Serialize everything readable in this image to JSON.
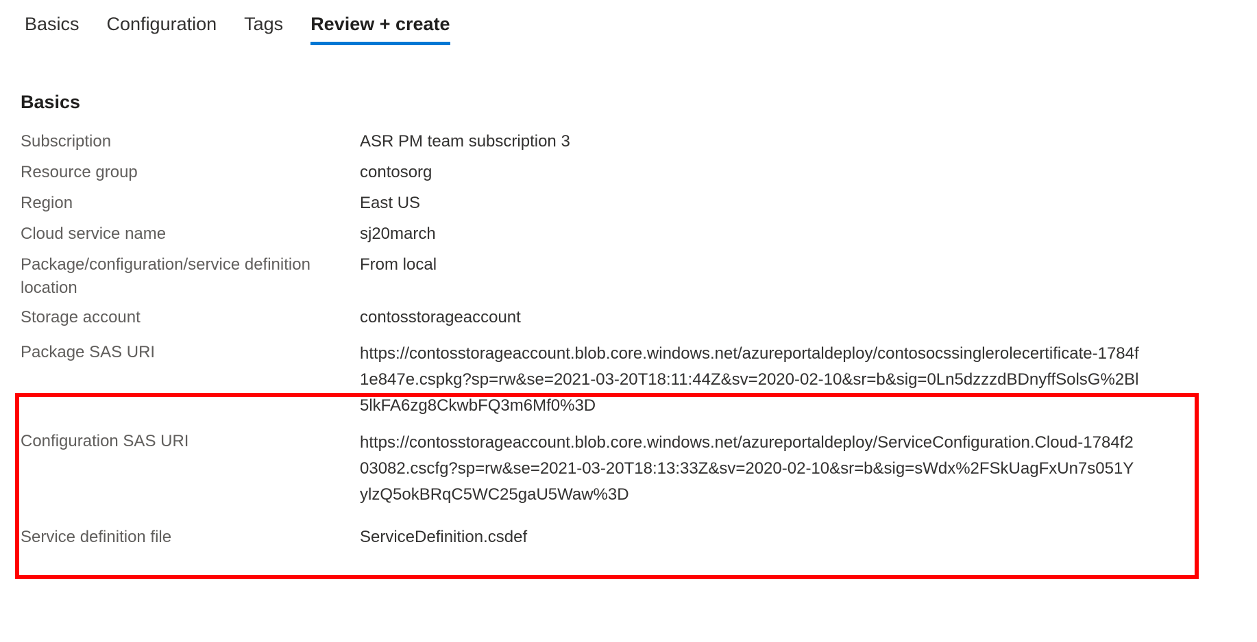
{
  "tabs": [
    {
      "label": "Basics",
      "active": false
    },
    {
      "label": "Configuration",
      "active": false
    },
    {
      "label": "Tags",
      "active": false
    },
    {
      "label": "Review + create",
      "active": true
    }
  ],
  "section": {
    "title": "Basics"
  },
  "fields": [
    {
      "label": "Subscription",
      "value": "ASR PM team subscription 3"
    },
    {
      "label": "Resource group",
      "value": "contosorg"
    },
    {
      "label": "Region",
      "value": "East US"
    },
    {
      "label": "Cloud service name",
      "value": "sj20march"
    },
    {
      "label": "Package/configuration/service definition location",
      "value": "From local"
    },
    {
      "label": "Storage account",
      "value": "contosstorageaccount"
    },
    {
      "label": "Package SAS URI",
      "value": "https://contosstorageaccount.blob.core.windows.net/azureportaldeploy/contosocssinglerolecertificate-1784f1e847e.cspkg?sp=rw&se=2021-03-20T18:11:44Z&sv=2020-02-10&sr=b&sig=0Ln5dzzzdBDnyffSolsG%2Bl5lkFA6zg8CkwbFQ3m6Mf0%3D"
    },
    {
      "label": "Configuration SAS URI",
      "value": "https://contosstorageaccount.blob.core.windows.net/azureportaldeploy/ServiceConfiguration.Cloud-1784f203082.cscfg?sp=rw&se=2021-03-20T18:13:33Z&sv=2020-02-10&sr=b&sig=sWdx%2FSkUagFxUn7s051YylzQ5okBRqC5WC25gaU5Waw%3D"
    },
    {
      "label": "Service definition file",
      "value": "ServiceDefinition.csdef"
    }
  ],
  "annotation": {
    "type": "rectangle-highlight",
    "color": "#ff0000",
    "targets": [
      "Package SAS URI",
      "Configuration SAS URI"
    ]
  },
  "colors": {
    "accent": "#0078d4",
    "label": "#605e5c",
    "value": "#323130",
    "highlight": "#ff0000"
  }
}
